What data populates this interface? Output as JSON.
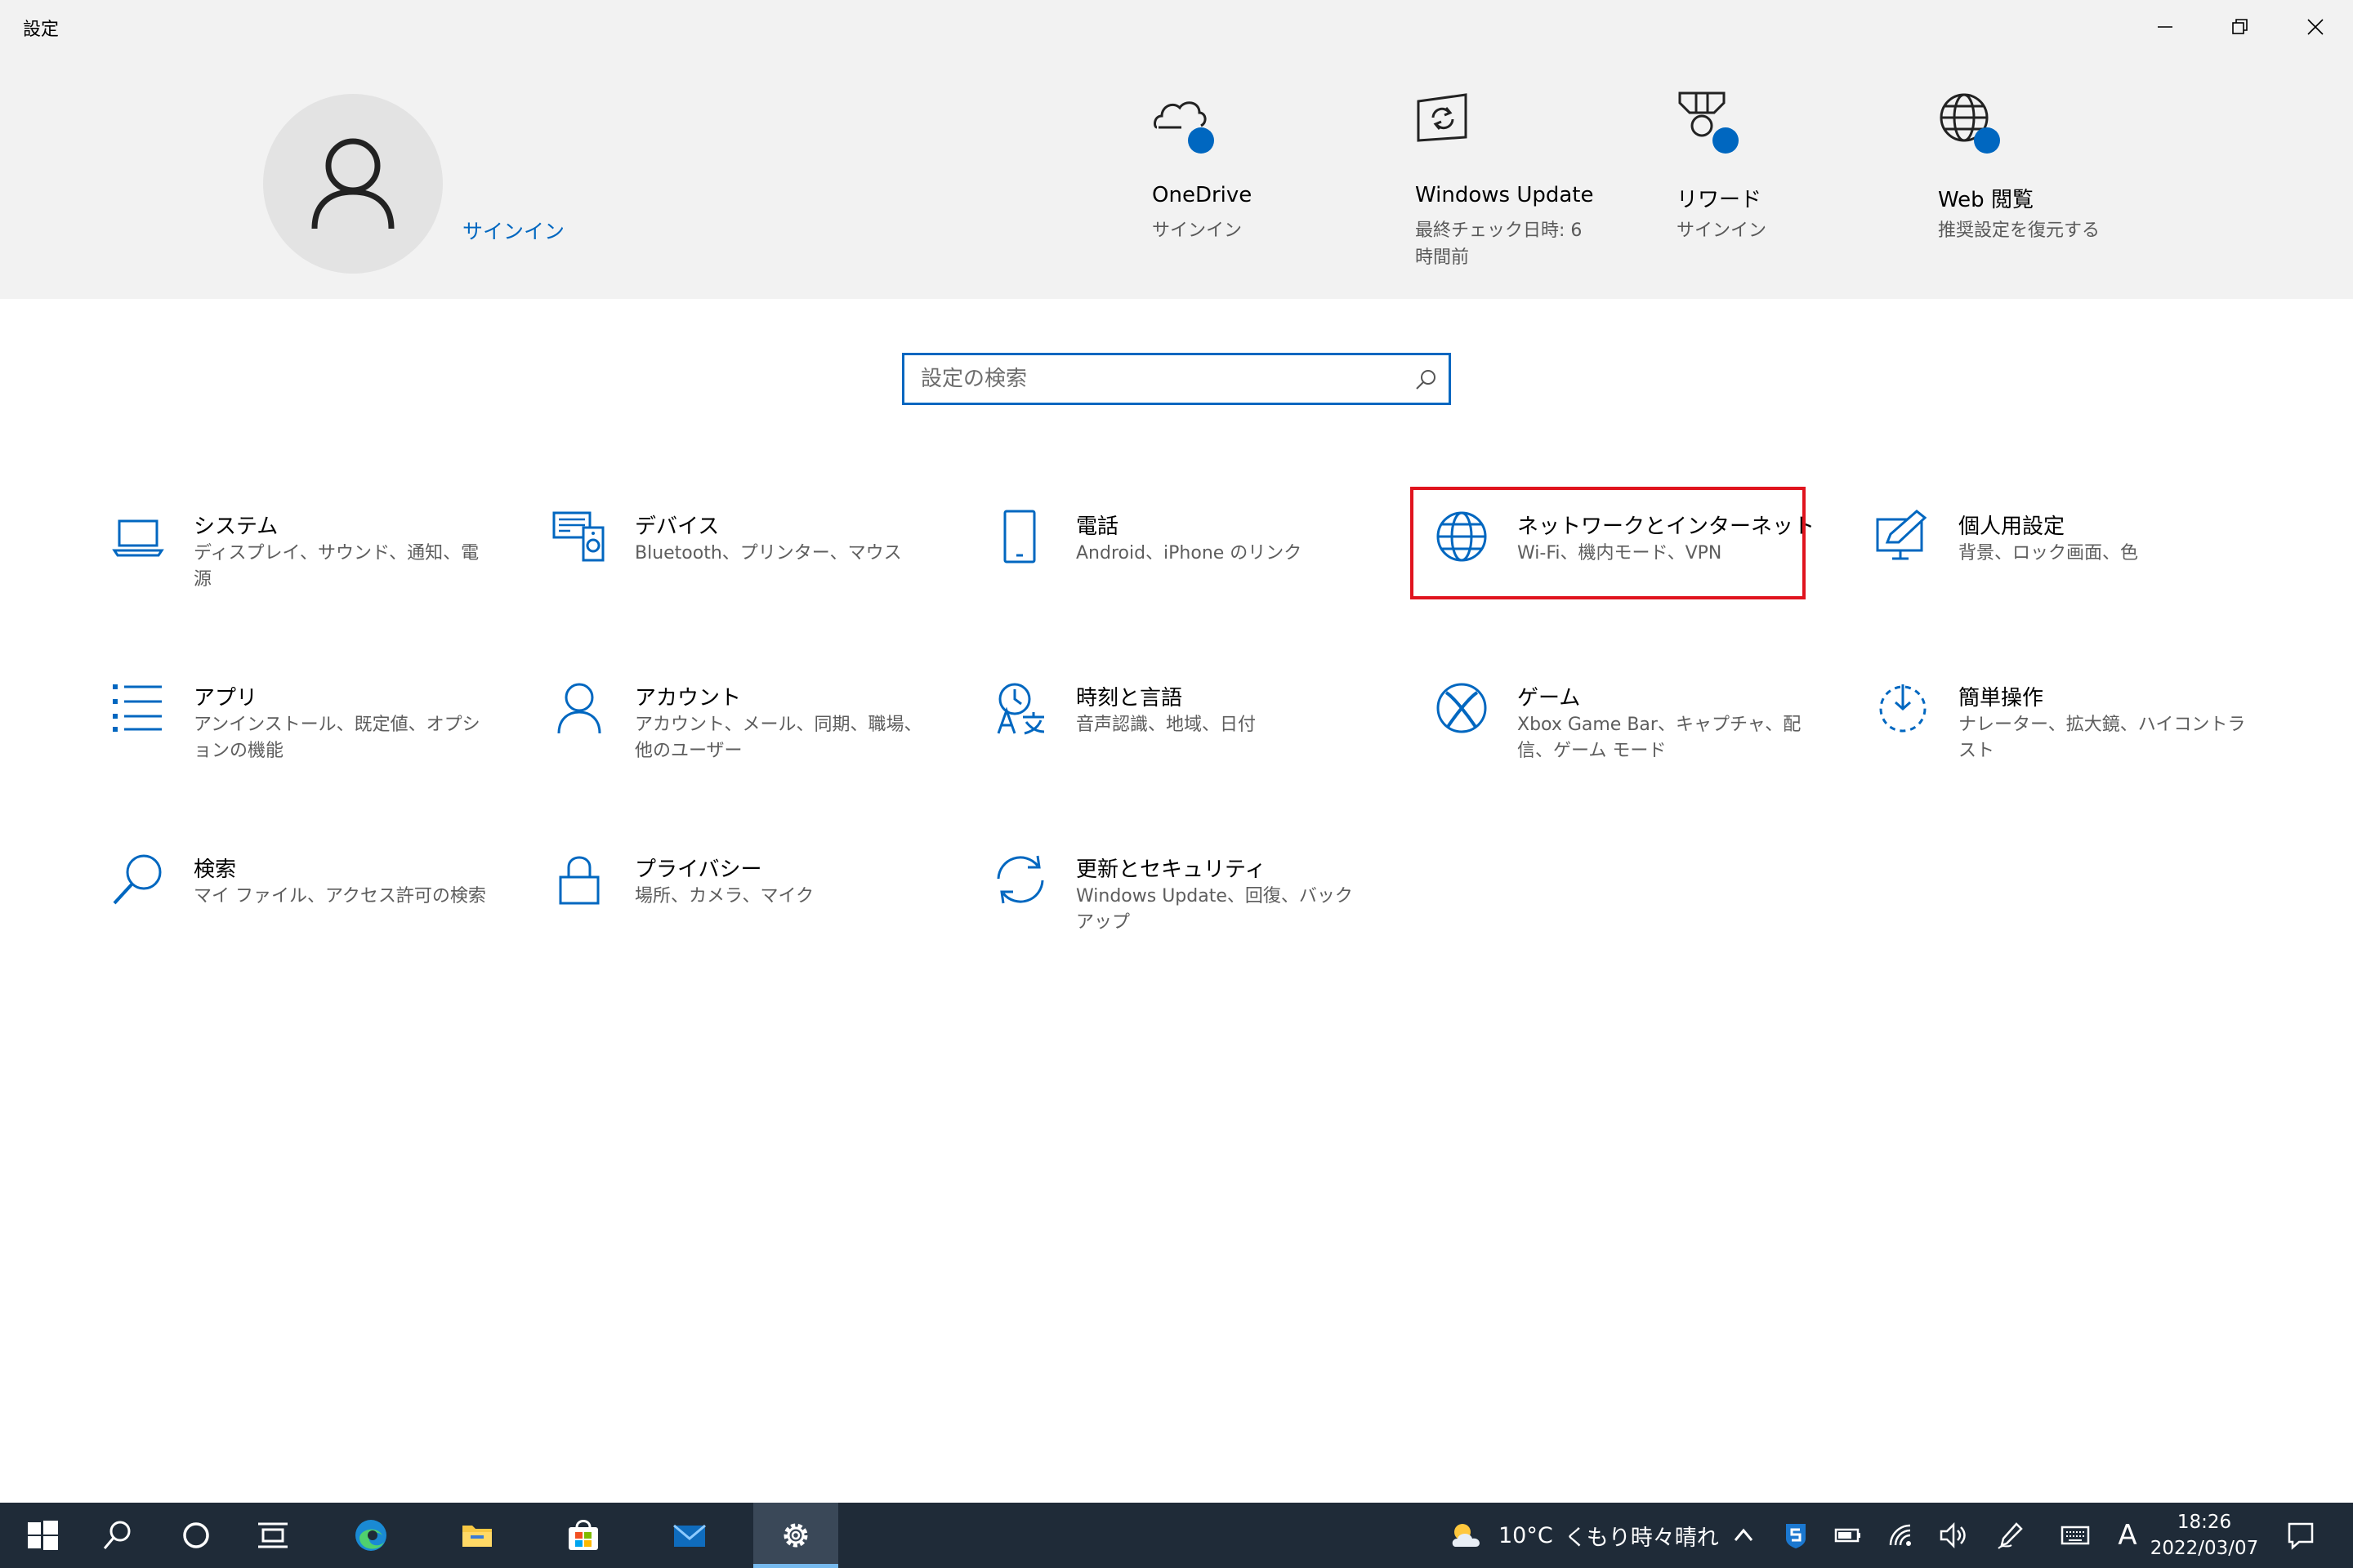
{
  "window": {
    "title": "設定"
  },
  "header": {
    "signin_label": "サインイン",
    "items": [
      {
        "title": "OneDrive",
        "subtitle": "サインイン"
      },
      {
        "title": "Windows Update",
        "subtitle": "最終チェック日時: 6 時間前"
      },
      {
        "title": "リワード",
        "subtitle": "サインイン"
      },
      {
        "title": "Web 閲覧",
        "subtitle": "推奨設定を復元する"
      }
    ]
  },
  "search": {
    "placeholder": "設定の検索"
  },
  "tiles": [
    {
      "title": "システム",
      "subtitle": "ディスプレイ、サウンド、通知、電源",
      "icon": "laptop-icon"
    },
    {
      "title": "デバイス",
      "subtitle": "Bluetooth、プリンター、マウス",
      "icon": "devices-icon"
    },
    {
      "title": "電話",
      "subtitle": "Android、iPhone のリンク",
      "icon": "phone-icon"
    },
    {
      "title": "ネットワークとインターネット",
      "subtitle": "Wi-Fi、機内モード、VPN",
      "icon": "globe-icon"
    },
    {
      "title": "個人用設定",
      "subtitle": "背景、ロック画面、色",
      "icon": "personalization-icon"
    },
    {
      "title": "アプリ",
      "subtitle": "アンインストール、既定値、オプションの機能",
      "icon": "apps-list-icon"
    },
    {
      "title": "アカウント",
      "subtitle": "アカウント、メール、同期、職場、他のユーザー",
      "icon": "person-icon"
    },
    {
      "title": "時刻と言語",
      "subtitle": "音声認識、地域、日付",
      "icon": "time-language-icon"
    },
    {
      "title": "ゲーム",
      "subtitle": "Xbox Game Bar、キャプチャ、配信、ゲーム モード",
      "icon": "xbox-icon"
    },
    {
      "title": "簡単操作",
      "subtitle": "ナレーター、拡大鏡、ハイコントラスト",
      "icon": "ease-of-access-icon"
    },
    {
      "title": "検索",
      "subtitle": "マイ ファイル、アクセス許可の検索",
      "icon": "search-icon"
    },
    {
      "title": "プライバシー",
      "subtitle": "場所、カメラ、マイク",
      "icon": "lock-icon"
    },
    {
      "title": "更新とセキュリティ",
      "subtitle": "Windows Update、回復、バックアップ",
      "icon": "sync-icon"
    }
  ],
  "taskbar": {
    "weather_temp": "10°C",
    "weather_text": "くもり時々晴れ",
    "ime_label": "A",
    "time": "18:26",
    "date": "2022/03/07"
  },
  "colors": {
    "accent": "#0067c0",
    "highlight": "#e0141e",
    "header_bg": "#f2f2f2",
    "taskbar_bg": "#1f2b38"
  }
}
